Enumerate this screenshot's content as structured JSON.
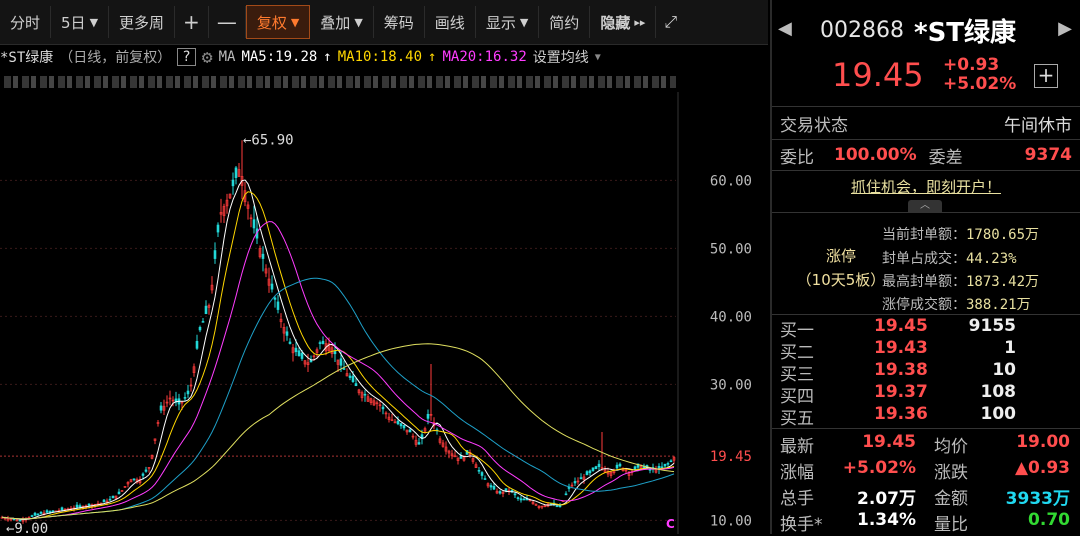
{
  "toolbar": {
    "items": [
      "分时",
      "5日",
      "更多周",
      "+",
      "—",
      "复权",
      "叠加",
      "筹码",
      "画线",
      "显示",
      "简约",
      "隐藏"
    ],
    "active": "复权",
    "hide_arrows": "▸▸"
  },
  "chart_header": {
    "name": "*ST绿康",
    "mode": "（日线，前复权）",
    "help": "?",
    "ma_label": "MA",
    "ma5": "MA5:19.28",
    "ma10": "MA10:18.40",
    "ma20": "MA20:16.32",
    "settings": "设置均线",
    "ma5_color": "#ffffff",
    "ma10_color": "#ffd700",
    "ma20_color": "#ff3cff"
  },
  "chart_data": {
    "type": "candlestick",
    "y_ticks": [
      "60.00",
      "50.00",
      "40.00",
      "30.00",
      "10.00"
    ],
    "y_tick_values": [
      60,
      50,
      40,
      30,
      10
    ],
    "ylim": [
      8,
      73
    ],
    "max_label": "65.90",
    "max_value": 65.9,
    "min_label": "9.00",
    "min_value": 9.0,
    "current_label": "19.45",
    "current_value": 19.45,
    "close_points": [
      [
        0,
        10.5
      ],
      [
        20,
        10
      ],
      [
        40,
        11
      ],
      [
        60,
        11.5
      ],
      [
        80,
        12
      ],
      [
        100,
        12.5
      ],
      [
        110,
        13
      ],
      [
        120,
        14
      ],
      [
        130,
        16
      ],
      [
        140,
        16
      ],
      [
        150,
        18
      ],
      [
        160,
        26
      ],
      [
        170,
        28
      ],
      [
        180,
        27
      ],
      [
        190,
        29
      ],
      [
        200,
        38
      ],
      [
        210,
        42
      ],
      [
        220,
        55
      ],
      [
        230,
        58
      ],
      [
        240,
        62
      ],
      [
        250,
        55
      ],
      [
        260,
        50
      ],
      [
        270,
        45
      ],
      [
        280,
        40
      ],
      [
        290,
        36
      ],
      [
        300,
        34
      ],
      [
        310,
        33
      ],
      [
        320,
        36
      ],
      [
        330,
        36
      ],
      [
        340,
        33
      ],
      [
        350,
        31
      ],
      [
        360,
        29
      ],
      [
        370,
        28
      ],
      [
        380,
        27
      ],
      [
        390,
        25
      ],
      [
        400,
        24
      ],
      [
        410,
        23
      ],
      [
        420,
        21
      ],
      [
        430,
        26
      ],
      [
        440,
        22
      ],
      [
        450,
        20
      ],
      [
        460,
        19
      ],
      [
        470,
        20
      ],
      [
        480,
        17
      ],
      [
        490,
        15
      ],
      [
        500,
        14
      ],
      [
        510,
        14.5
      ],
      [
        520,
        13
      ],
      [
        530,
        13
      ],
      [
        540,
        12
      ],
      [
        550,
        12.5
      ],
      [
        560,
        12
      ],
      [
        570,
        15
      ],
      [
        580,
        16
      ],
      [
        590,
        17
      ],
      [
        600,
        18
      ],
      [
        610,
        17
      ],
      [
        620,
        18
      ],
      [
        630,
        17
      ],
      [
        640,
        18
      ],
      [
        650,
        17.5
      ],
      [
        660,
        17.5
      ],
      [
        670,
        18.5
      ],
      [
        675,
        19.45
      ]
    ]
  },
  "stock": {
    "code": "002868",
    "name": "*ST绿康",
    "price": "19.45",
    "change": "+0.93",
    "change_pct": "+5.02%",
    "prev": "◀",
    "next": "▶",
    "add": "+"
  },
  "status": {
    "label": "交易状态",
    "value": "午间休市",
    "weibi_label": "委比",
    "weibi": "100.00%",
    "weicha_label": "委差",
    "weicha": "9374"
  },
  "promo": "抓住机会，即刻开户！",
  "limit_up": {
    "title": "涨停",
    "sub": "（10天5板）",
    "rows": [
      {
        "label": "当前封单额：",
        "value": "1780.65万"
      },
      {
        "label": "封单占成交：",
        "value": "44.23%"
      },
      {
        "label": "最高封单额：",
        "value": "1873.42万"
      },
      {
        "label": "涨停成交额：",
        "value": "388.21万"
      }
    ]
  },
  "orderbook": [
    {
      "label": "买一",
      "price": "19.45",
      "vol": "9155"
    },
    {
      "label": "买二",
      "price": "19.43",
      "vol": "1"
    },
    {
      "label": "买三",
      "price": "19.38",
      "vol": "10"
    },
    {
      "label": "买四",
      "price": "19.37",
      "vol": "108"
    },
    {
      "label": "买五",
      "price": "19.36",
      "vol": "100"
    }
  ],
  "quote": {
    "latest_label": "最新",
    "latest": "19.45",
    "avg_label": "均价",
    "avg": "19.00",
    "pct_label": "涨幅",
    "pct": "+5.02%",
    "chg_label": "涨跌",
    "chg": "▲0.93",
    "vol_label": "总手",
    "vol": "2.07万",
    "amt_label": "金额",
    "amt": "3933万",
    "turn_label": "换手*",
    "turn": "1.34%",
    "vr_label": "量比",
    "vr": "0.70"
  }
}
